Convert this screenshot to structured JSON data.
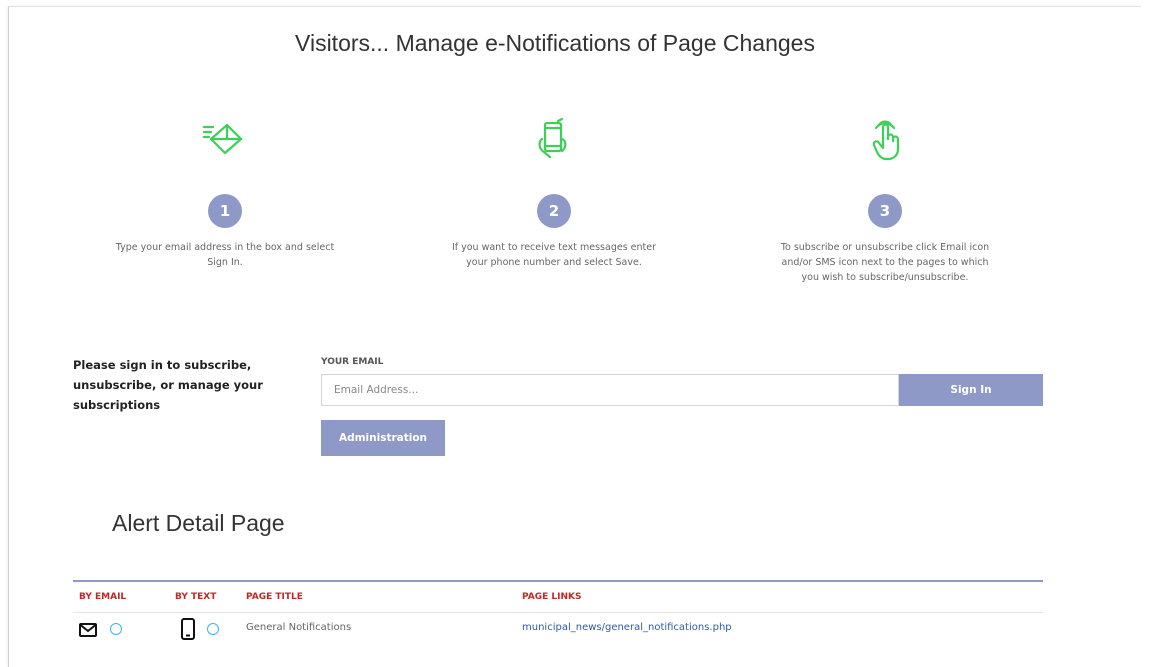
{
  "header": {
    "title": "Visitors... Manage e-Notifications of Page Changes"
  },
  "steps": [
    {
      "number": "1",
      "icon": "envelope-send-icon",
      "text": "Type your email address in the box and select Sign In."
    },
    {
      "number": "2",
      "icon": "phone-hand-icon",
      "text": "If you want to receive text messages enter your phone number and select Save."
    },
    {
      "number": "3",
      "icon": "tap-hand-icon",
      "text": "To subscribe or unsubscribe click Email icon and/or SMS icon next to the pages to which you wish to subscribe/unsubscribe."
    }
  ],
  "signin": {
    "note": "Please sign in to subscribe, unsubscribe, or manage your subscriptions",
    "email_label": "YOUR EMAIL",
    "email_placeholder": "Email Address...",
    "email_value": "",
    "signin_label": "Sign In",
    "admin_label": "Administration"
  },
  "alerts": {
    "title": "Alert Detail Page",
    "columns": [
      "BY EMAIL",
      "BY TEXT",
      "PAGE TITLE",
      "PAGE LINKS"
    ],
    "rows": [
      {
        "page_title": "General Notifications",
        "page_link": "municipal_news/general_notifications.php"
      }
    ]
  },
  "colors": {
    "accent": "#8e99c7",
    "icon_green": "#3ecf5a",
    "header_red": "#c02828",
    "link_blue": "#2e5aa8",
    "radio_blue": "#3ab4ea"
  }
}
